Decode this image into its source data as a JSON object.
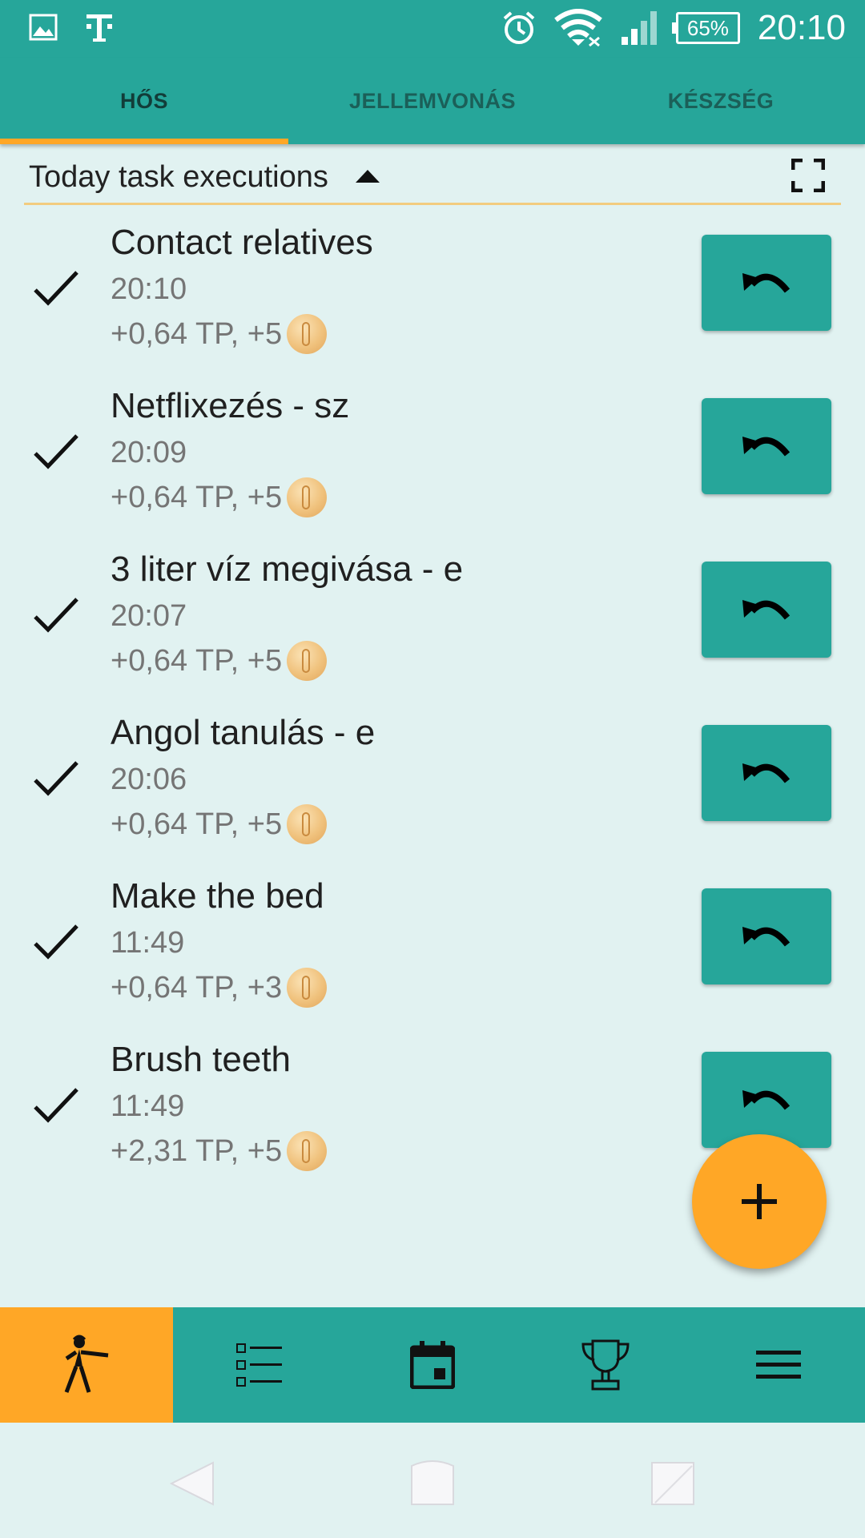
{
  "status_bar": {
    "time": "20:10",
    "battery": "65%",
    "icons": [
      "image-icon",
      "telekom-icon",
      "alarm-icon",
      "wifi-icon",
      "signal-icon",
      "battery-icon"
    ]
  },
  "tabs": [
    {
      "label": "HŐS",
      "active": true
    },
    {
      "label": "JELLEMVONÁS",
      "active": false
    },
    {
      "label": "KÉSZSÉG",
      "active": false
    }
  ],
  "section": {
    "title": "Today task executions"
  },
  "tasks": [
    {
      "name": "Contact relatives",
      "time": "20:10",
      "reward": "+0,64 TP, +5"
    },
    {
      "name": "Netflixezés - sz",
      "time": "20:09",
      "reward": "+0,64 TP, +5"
    },
    {
      "name": "3 liter víz megivása - e",
      "time": "20:07",
      "reward": "+0,64 TP, +5"
    },
    {
      "name": "Angol tanulás - e",
      "time": "20:06",
      "reward": "+0,64 TP, +5"
    },
    {
      "name": "Make the bed",
      "time": "11:49",
      "reward": "+0,64 TP, +3"
    },
    {
      "name": "Brush teeth",
      "time": "11:49",
      "reward": "+2,31 TP, +5"
    }
  ],
  "bottom_nav": [
    {
      "icon": "hero-icon",
      "active": true
    },
    {
      "icon": "task-list-icon",
      "active": false
    },
    {
      "icon": "calendar-icon",
      "active": false
    },
    {
      "icon": "trophy-icon",
      "active": false
    },
    {
      "icon": "menu-icon",
      "active": false
    }
  ],
  "colors": {
    "primary": "#26a69a",
    "accent": "#ffa726",
    "background": "#e1f2f1"
  }
}
